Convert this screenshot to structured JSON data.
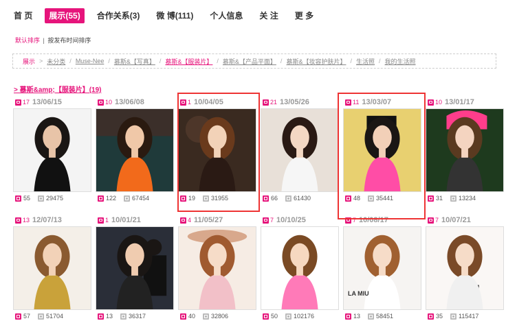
{
  "nav": {
    "items": [
      {
        "label": "首 页",
        "active": false
      },
      {
        "label": "展示(55)",
        "active": true
      },
      {
        "label": "合作关系(3)",
        "active": false
      },
      {
        "label": "微 博(111)",
        "active": false
      },
      {
        "label": "个人信息",
        "active": false
      },
      {
        "label": "关 注",
        "active": false
      },
      {
        "label": "更 多",
        "active": false
      }
    ]
  },
  "sort": {
    "default": "默认排序",
    "separator": "|",
    "by_time": "按发布时间排序"
  },
  "breadcrumbs": [
    {
      "label": "展示",
      "active": true
    },
    {
      "label": "未分类",
      "active": false
    },
    {
      "label": "Muse-Nee",
      "active": false
    },
    {
      "label": "慕斯&【写真】",
      "active": false
    },
    {
      "label": "慕斯&【服装片】",
      "active": true
    },
    {
      "label": "慕斯&【产品平面】",
      "active": false
    },
    {
      "label": "慕斯&【妆容护肤片】",
      "active": false
    },
    {
      "label": "生活照",
      "active": false
    },
    {
      "label": "我的生活照",
      "active": false
    }
  ],
  "breadcrumb_sep": "/",
  "breadcrumb_arrow": ">",
  "album": {
    "title": "> 慕斯&amp;【服装片】(19)"
  },
  "photos": [
    {
      "count": "17",
      "date": "13/06/15",
      "likes": "55",
      "views": "29475",
      "highlighted": false,
      "scene": "dark",
      "caption": ""
    },
    {
      "count": "10",
      "date": "13/06/08",
      "likes": "122",
      "views": "67454",
      "highlighted": false,
      "scene": "orange",
      "caption": ""
    },
    {
      "count": "1",
      "date": "10/04/05",
      "likes": "19",
      "views": "31955",
      "highlighted": true,
      "scene": "brown",
      "caption": ""
    },
    {
      "count": "21",
      "date": "13/05/26",
      "likes": "66",
      "views": "61430",
      "highlighted": false,
      "scene": "light",
      "caption": ""
    },
    {
      "count": "11",
      "date": "13/03/07",
      "likes": "48",
      "views": "35441",
      "highlighted": true,
      "scene": "pink",
      "caption": ""
    },
    {
      "count": "10",
      "date": "13/01/17",
      "likes": "31",
      "views": "13234",
      "highlighted": false,
      "scene": "hat",
      "caption": ""
    },
    {
      "count": "13",
      "date": "12/07/13",
      "likes": "57",
      "views": "51704",
      "highlighted": false,
      "scene": "gold",
      "caption": ""
    },
    {
      "count": "1",
      "date": "10/01/21",
      "likes": "13",
      "views": "36317",
      "highlighted": false,
      "scene": "duo",
      "caption": ""
    },
    {
      "count": "4",
      "date": "11/05/27",
      "likes": "40",
      "views": "32806",
      "highlighted": false,
      "scene": "flower",
      "caption": ""
    },
    {
      "count": "7",
      "date": "10/10/25",
      "likes": "50",
      "views": "102176",
      "highlighted": false,
      "scene": "bikini",
      "caption": ""
    },
    {
      "count": "7",
      "date": "10/08/17",
      "likes": "13",
      "views": "58451",
      "highlighted": false,
      "scene": "white",
      "caption": "LA MIU"
    },
    {
      "count": "7",
      "date": "10/07/21",
      "likes": "35",
      "views": "115417",
      "highlighted": false,
      "scene": "pale",
      "caption": ""
    }
  ],
  "colors": {
    "accent": "#e6147b",
    "highlight": "#e33333"
  }
}
